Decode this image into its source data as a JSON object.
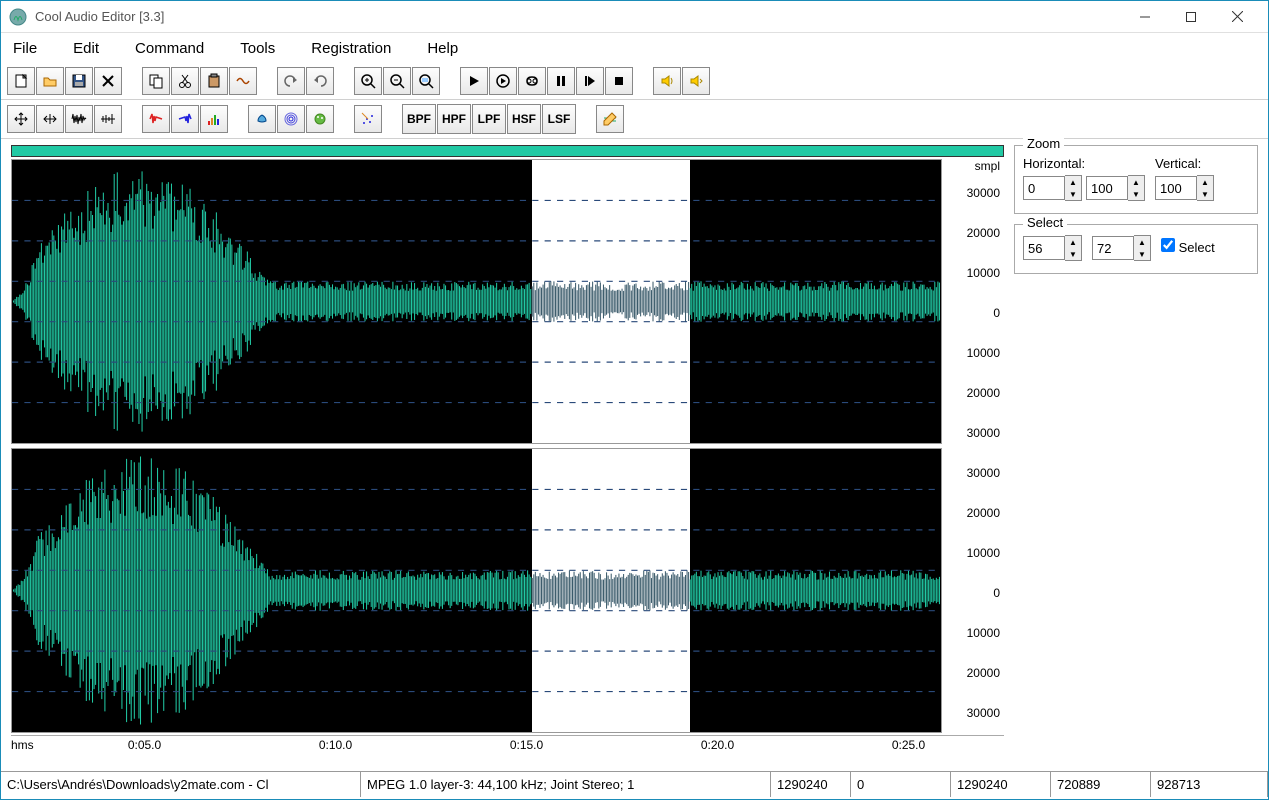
{
  "window": {
    "title": "Cool Audio Editor [3.3]"
  },
  "menu": {
    "items": [
      "File",
      "Edit",
      "Command",
      "Tools",
      "Registration",
      "Help"
    ]
  },
  "toolbar1": {
    "groups": [
      [
        "new",
        "open",
        "save",
        "delete"
      ],
      [
        "copy",
        "cut",
        "paste",
        "crop"
      ],
      [
        "undo",
        "redo"
      ],
      [
        "zoom-in",
        "zoom-out",
        "zoom-sel"
      ],
      [
        "play",
        "play-loop",
        "loop",
        "pause",
        "step",
        "stop"
      ],
      [
        "speaker-left",
        "speaker-right"
      ]
    ]
  },
  "toolbar2": {
    "groups": [
      [
        "expand",
        "collapse",
        "wave1",
        "wave2"
      ],
      [
        "red-wave",
        "blue-wave",
        "spectrum"
      ],
      [
        "effect1",
        "effect2",
        "effect3"
      ],
      [
        "noise"
      ]
    ],
    "filters": [
      "BPF",
      "HPF",
      "LPF",
      "HSF",
      "LSF"
    ],
    "extra": [
      "edit-tool"
    ]
  },
  "waveform": {
    "amplitude_unit": "smpl",
    "amplitude_ticks": [
      "30000",
      "20000",
      "10000",
      "0",
      "10000",
      "20000",
      "30000"
    ],
    "time_unit": "hms",
    "time_ticks": [
      "0:05.0",
      "0:10.0",
      "0:15.0",
      "0:20.0",
      "0:25.0"
    ],
    "selection_start_pct": 56,
    "selection_width_pct": 17
  },
  "zoom": {
    "legend": "Zoom",
    "horizontal_label": "Horizontal:",
    "vertical_label": "Vertical:",
    "h_start": "0",
    "h_end": "100",
    "v_val": "100"
  },
  "select": {
    "legend": "Select",
    "start": "56",
    "end": "72",
    "check_label": "Select",
    "checked": true
  },
  "status": {
    "path": "C:\\Users\\Andrés\\Downloads\\y2mate.com - Cl",
    "format": "MPEG 1.0 layer-3: 44,100 kHz; Joint Stereo; 1",
    "v1": "1290240",
    "v2": "0",
    "v3": "1290240",
    "v4": "720889",
    "v5": "928713"
  }
}
